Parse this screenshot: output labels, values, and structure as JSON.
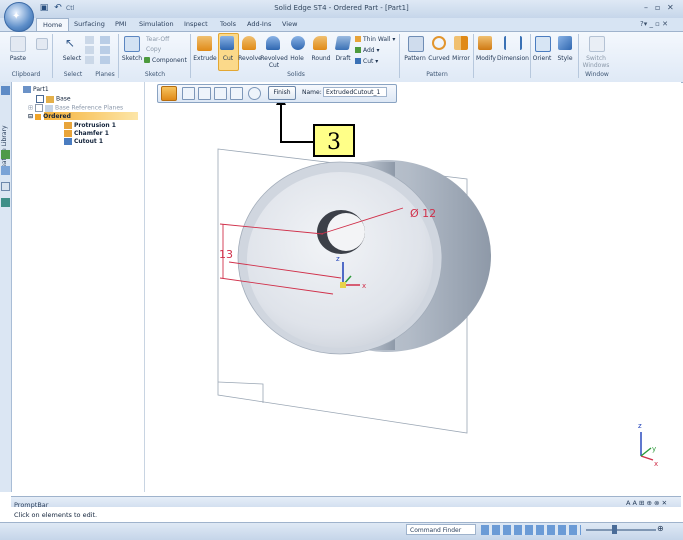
{
  "app": {
    "title": "Solid Edge ST4 - Ordered Part - [Part1]",
    "quick_access_extra": "Ctl"
  },
  "menu_tabs": [
    "Home",
    "Surfacing",
    "PMI",
    "Simulation",
    "Inspect",
    "Tools",
    "Add-Ins",
    "View"
  ],
  "ribbon": {
    "clipboard": {
      "paste": "Paste",
      "label": "Clipboard"
    },
    "select": {
      "select": "Select",
      "label": "Select"
    },
    "planes": {
      "label": "Planes"
    },
    "sketch": {
      "sketch": "Sketch",
      "tear_off": "Tear-Off",
      "copy": "Copy",
      "component": "Component",
      "label": "Sketch"
    },
    "solids": {
      "extrude": "Extrude",
      "cut": "Cut",
      "revolve": "Revolve",
      "revolved_cut": "Revolved Cut",
      "hole": "Hole",
      "round": "Round",
      "draft": "Draft",
      "thin_wall": "Thin Wall",
      "add": "Add",
      "cut_small": "Cut",
      "label": "Solids"
    },
    "pattern": {
      "pattern": "Pattern",
      "curved": "Curved",
      "mirror": "Mirror",
      "label": "Pattern"
    },
    "modify": "Modify",
    "dimension": "Dimension",
    "orient": "Orient",
    "style": "Style",
    "window": {
      "switch": "Switch Windows",
      "label": "Window"
    }
  },
  "left_tab": "Feature Library",
  "tree": {
    "root": "Part1",
    "base": "Base",
    "base_ref": "Base Reference Planes",
    "ordered": "Ordered",
    "items": [
      "Protrusion 1",
      "Chamfer 1",
      "Cutout 1"
    ]
  },
  "command_bar": {
    "finish": "Finish",
    "name_label": "Name:",
    "name_value": "ExtrudedCutout_1"
  },
  "callout": "3",
  "viewport": {
    "diameter_dim": "Ø 12",
    "height_dim": "13",
    "axis_x": "x",
    "axis_y": "y",
    "axis_z": "z"
  },
  "prompt_bar": {
    "title": "PromptBar",
    "text": "Click on elements to edit."
  },
  "status": {
    "command_finder": "Command Finder"
  },
  "colors": {
    "accent_orange": "#f5b23b",
    "dimension_red": "#d0304a",
    "callout_yellow": "#ffff88"
  }
}
